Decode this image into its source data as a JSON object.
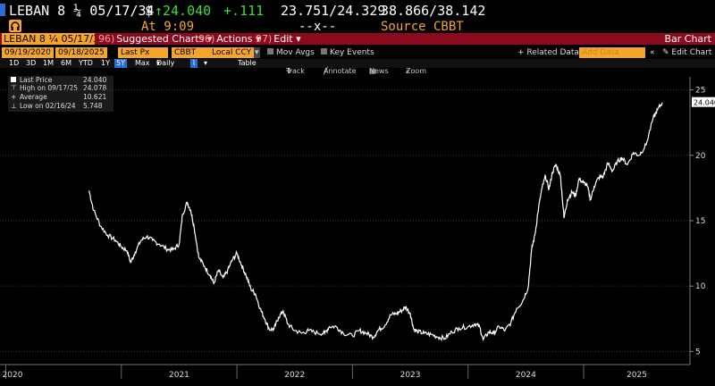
{
  "header": {
    "ticker": "LEBAN 8 ¼ 05/17/34",
    "price_prefix": "$",
    "arrow": "↑",
    "price": "24.040",
    "change": "+.111",
    "bid_ask": "23.751/24.329",
    "yield": "38.866/38.142",
    "time_label": "At 9:09",
    "size": "--x--",
    "source_label": "Source CBBT",
    "accent_green": "#3ddc3d",
    "accent_orange": "#f4a52a",
    "accent_yellow": "#ffd24d"
  },
  "menu": {
    "security": "LEBAN 8 ¼ 05/17/3",
    "charts_num": "96)",
    "charts": "Suggested Charts",
    "actions_num": "96)",
    "actions": "Actions",
    "edit_num": "97)",
    "edit": "Edit",
    "right": "Bar Chart"
  },
  "controls": {
    "start_date": "09/19/2020",
    "end_date": "09/18/2025",
    "field": "Last Px",
    "source": "CBBT",
    "currency": "Local CCY",
    "mov_avgs": "Mov Avgs",
    "key_events": "Key Events",
    "related": "+ Related Data",
    "add_data": "Add Data",
    "edit_chart": "Edit Chart",
    "periods": [
      "1D",
      "3D",
      "1M",
      "6M",
      "YTD",
      "1Y",
      "5Y",
      "Max"
    ],
    "active_period": "5Y",
    "frequency": "Daily",
    "table": "Table",
    "tools": [
      "Track",
      "Annotate",
      "News",
      "Zoom"
    ]
  },
  "legend": {
    "rows": [
      {
        "label": "Last Price",
        "value": "24.040"
      },
      {
        "label": "High on 09/17/25",
        "value": "24.078"
      },
      {
        "label": "Average",
        "value": "10.621"
      },
      {
        "label": "Low on 02/16/24",
        "value": "5.748"
      }
    ]
  },
  "chart_data": {
    "type": "line",
    "series": [
      {
        "color": "#ffffff",
        "points": [
          [
            2020.72,
            17.3
          ],
          [
            2020.76,
            15.8
          ],
          [
            2020.82,
            14.6
          ],
          [
            2020.88,
            13.9
          ],
          [
            2020.95,
            13.5
          ],
          [
            2021.0,
            13.0
          ],
          [
            2021.05,
            12.7
          ],
          [
            2021.08,
            11.8
          ],
          [
            2021.12,
            12.6
          ],
          [
            2021.17,
            13.5
          ],
          [
            2021.22,
            13.8
          ],
          [
            2021.27,
            13.5
          ],
          [
            2021.33,
            13.2
          ],
          [
            2021.4,
            12.8
          ],
          [
            2021.45,
            12.8
          ],
          [
            2021.5,
            13.2
          ],
          [
            2021.53,
            15.5
          ],
          [
            2021.57,
            16.4
          ],
          [
            2021.6,
            15.8
          ],
          [
            2021.63,
            14.5
          ],
          [
            2021.67,
            12.2
          ],
          [
            2021.72,
            11.5
          ],
          [
            2021.77,
            10.8
          ],
          [
            2021.8,
            10.2
          ],
          [
            2021.84,
            11.2
          ],
          [
            2021.88,
            10.6
          ],
          [
            2021.92,
            11.2
          ],
          [
            2021.96,
            12.0
          ],
          [
            2022.0,
            12.5
          ],
          [
            2022.04,
            11.6
          ],
          [
            2022.08,
            10.8
          ],
          [
            2022.12,
            9.8
          ],
          [
            2022.16,
            9.4
          ],
          [
            2022.2,
            8.3
          ],
          [
            2022.24,
            7.5
          ],
          [
            2022.28,
            6.7
          ],
          [
            2022.32,
            6.7
          ],
          [
            2022.36,
            7.6
          ],
          [
            2022.4,
            8.1
          ],
          [
            2022.44,
            7.1
          ],
          [
            2022.5,
            6.6
          ],
          [
            2022.56,
            6.4
          ],
          [
            2022.62,
            6.6
          ],
          [
            2022.7,
            6.4
          ],
          [
            2022.76,
            6.4
          ],
          [
            2022.8,
            6.9
          ],
          [
            2022.86,
            6.9
          ],
          [
            2022.92,
            6.4
          ],
          [
            2023.0,
            6.2
          ],
          [
            2023.06,
            6.6
          ],
          [
            2023.12,
            6.4
          ],
          [
            2023.18,
            6.1
          ],
          [
            2023.22,
            6.6
          ],
          [
            2023.28,
            7.0
          ],
          [
            2023.33,
            7.8
          ],
          [
            2023.38,
            7.9
          ],
          [
            2023.42,
            8.1
          ],
          [
            2023.46,
            8.4
          ],
          [
            2023.5,
            7.9
          ],
          [
            2023.53,
            6.7
          ],
          [
            2023.57,
            6.5
          ],
          [
            2023.62,
            6.4
          ],
          [
            2023.68,
            6.3
          ],
          [
            2023.74,
            6.1
          ],
          [
            2023.8,
            6.0
          ],
          [
            2023.86,
            6.5
          ],
          [
            2023.92,
            6.8
          ],
          [
            2024.0,
            6.9
          ],
          [
            2024.06,
            7.1
          ],
          [
            2024.1,
            6.9
          ],
          [
            2024.13,
            5.9
          ],
          [
            2024.18,
            6.5
          ],
          [
            2024.22,
            6.4
          ],
          [
            2024.27,
            6.9
          ],
          [
            2024.32,
            6.6
          ],
          [
            2024.37,
            7.2
          ],
          [
            2024.42,
            8.3
          ],
          [
            2024.47,
            8.8
          ],
          [
            2024.52,
            9.9
          ],
          [
            2024.55,
            12.8
          ],
          [
            2024.58,
            14.0
          ],
          [
            2024.61,
            16.0
          ],
          [
            2024.64,
            17.5
          ],
          [
            2024.67,
            18.4
          ],
          [
            2024.7,
            17.4
          ],
          [
            2024.73,
            18.7
          ],
          [
            2024.76,
            19.3
          ],
          [
            2024.8,
            18.4
          ],
          [
            2024.83,
            15.2
          ],
          [
            2024.86,
            16.6
          ],
          [
            2024.9,
            17.2
          ],
          [
            2024.93,
            16.9
          ],
          [
            2024.96,
            18.2
          ],
          [
            2025.0,
            17.9
          ],
          [
            2025.03,
            17.7
          ],
          [
            2025.06,
            16.6
          ],
          [
            2025.09,
            17.6
          ],
          [
            2025.13,
            18.3
          ],
          [
            2025.17,
            18.4
          ],
          [
            2025.21,
            19.4
          ],
          [
            2025.25,
            18.8
          ],
          [
            2025.29,
            19.5
          ],
          [
            2025.33,
            19.8
          ],
          [
            2025.38,
            19.3
          ],
          [
            2025.43,
            20.2
          ],
          [
            2025.48,
            20.0
          ],
          [
            2025.54,
            20.8
          ],
          [
            2025.6,
            22.8
          ],
          [
            2025.64,
            23.5
          ],
          [
            2025.68,
            24.04
          ]
        ]
      }
    ],
    "y_ticks": [
      "5",
      "10",
      "15",
      "20",
      "25"
    ],
    "x_ticks": [
      "2020",
      "2021",
      "2022",
      "2023",
      "2024",
      "2025"
    ],
    "x_ticks_pos": [
      2020,
      2021,
      2022,
      2023,
      2024,
      2025
    ],
    "y_ticks_pos": [
      5,
      10,
      15,
      20,
      25
    ],
    "xlim": [
      2019.95,
      2025.92
    ],
    "ylim": [
      4,
      26
    ],
    "last_label": "24.040",
    "grid": true
  }
}
